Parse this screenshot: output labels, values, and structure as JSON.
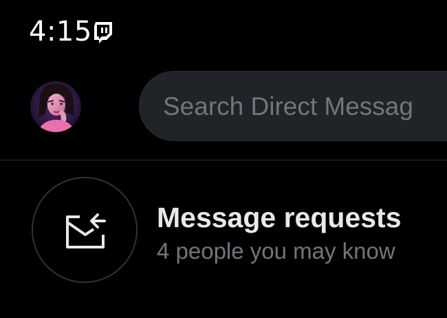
{
  "status_bar": {
    "time": "4:15",
    "notification_icon": "twitch-icon"
  },
  "header": {
    "avatar_icon": "profile-avatar",
    "search": {
      "placeholder": "Search Direct Messag"
    }
  },
  "message_requests": {
    "icon": "envelope-arrow-icon",
    "title": "Message requests",
    "subtitle": "4 people you may know"
  },
  "colors": {
    "background": "#000000",
    "primary_text": "#e7e9ea",
    "secondary_text": "#71767b",
    "search_fill": "#202327",
    "divider": "#2f3336"
  }
}
